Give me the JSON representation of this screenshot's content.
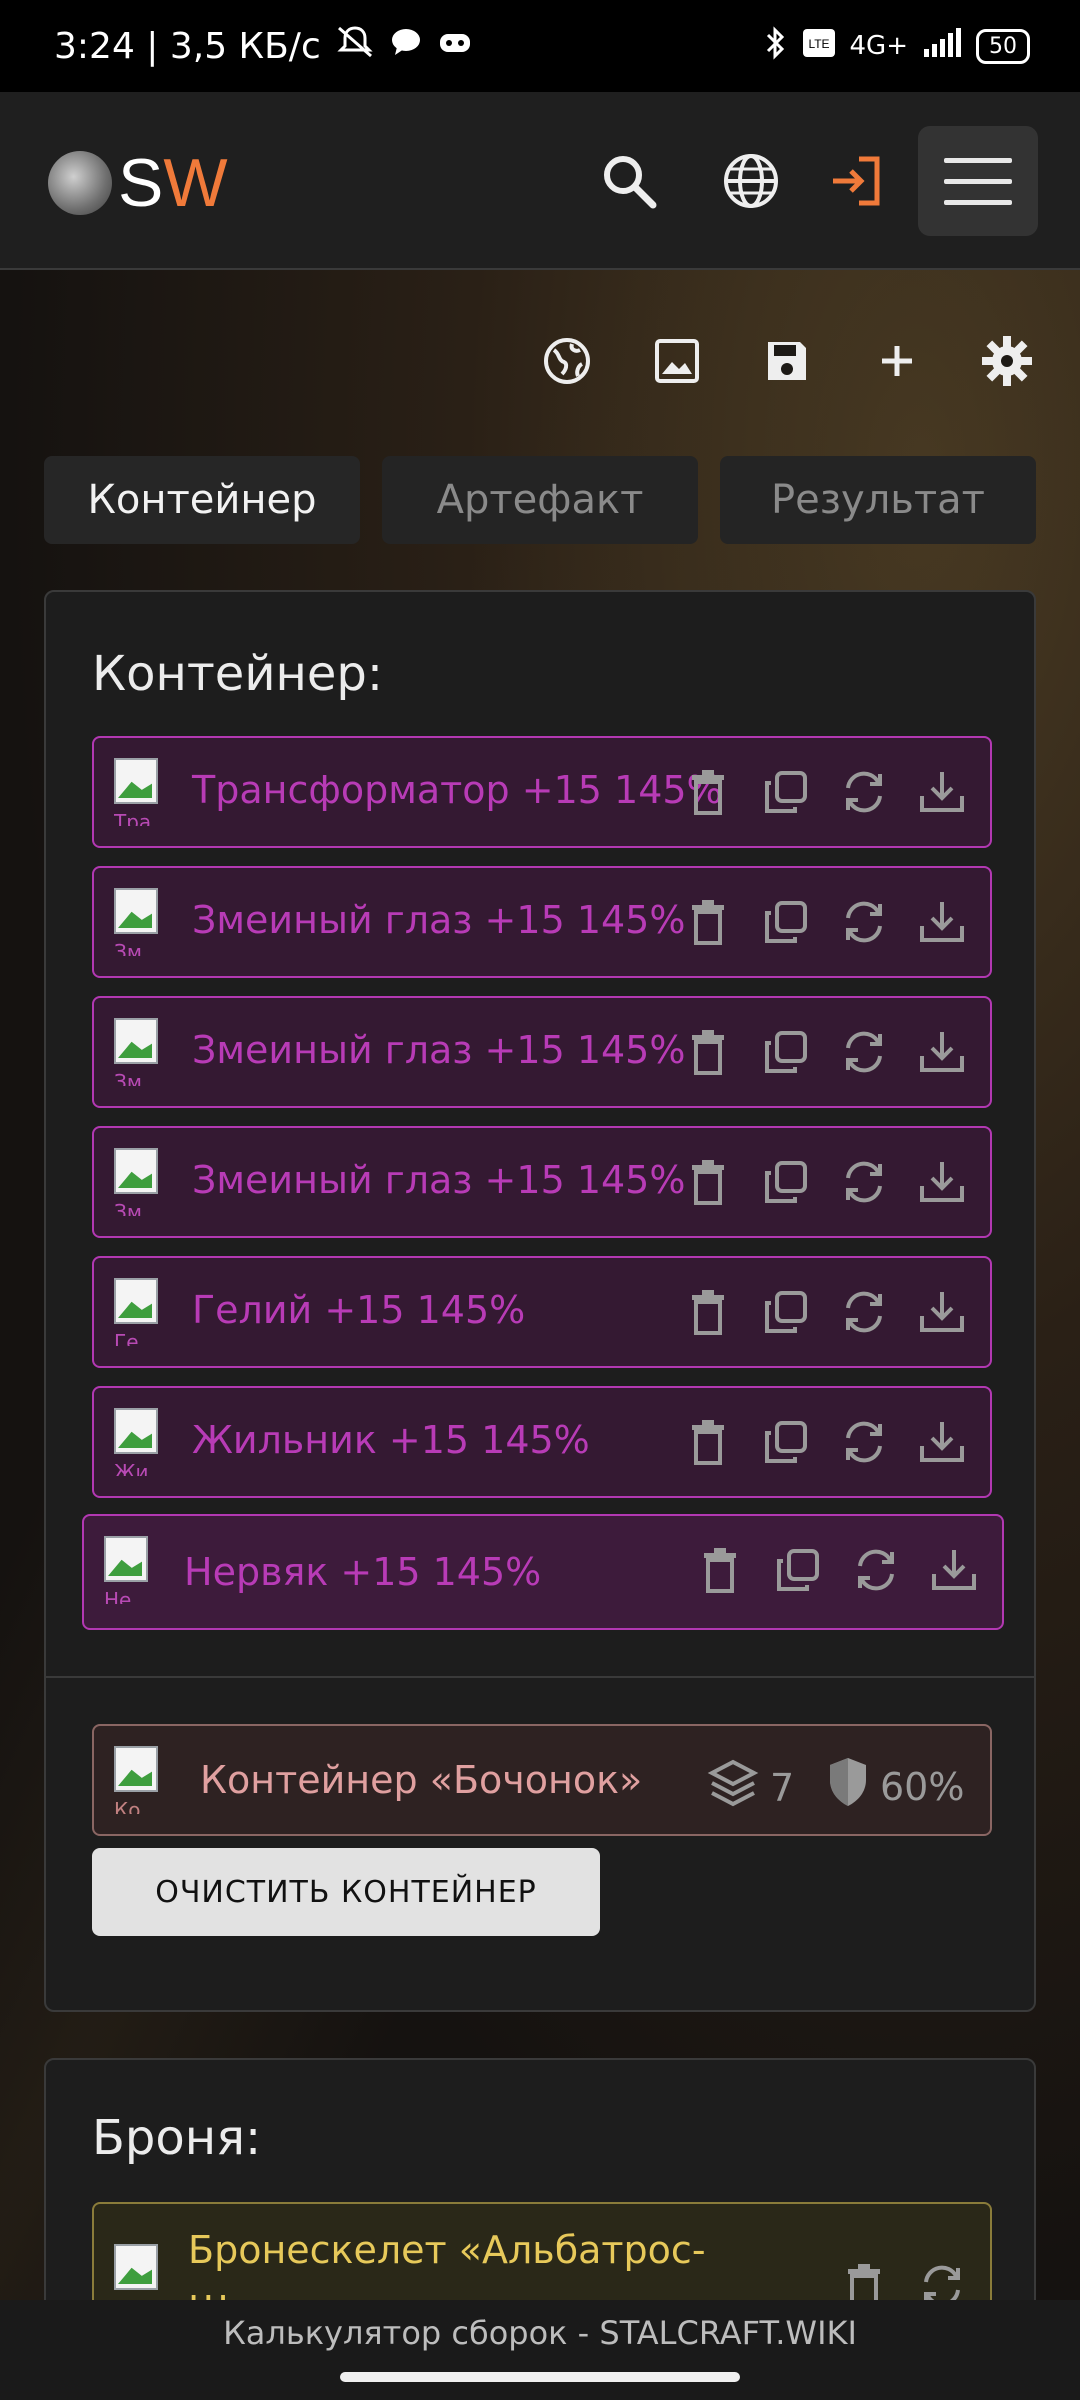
{
  "status_bar": {
    "time_speed": "3:24 | 3,5 КБ/с",
    "network": "4G+",
    "battery": "50"
  },
  "header": {
    "logo_s": "S",
    "logo_w": "W"
  },
  "toolbar": {
    "icons": [
      "globe-share-icon",
      "image-icon",
      "save-icon",
      "plus-icon",
      "gear-icon"
    ]
  },
  "tabs": [
    {
      "label": "Контейнер",
      "active": true
    },
    {
      "label": "Артефакт",
      "active": false
    },
    {
      "label": "Результат",
      "active": false
    }
  ],
  "container_panel": {
    "title": "Контейнер:",
    "artifacts": [
      {
        "name": "Трансформатор +15 145%",
        "alt_stub": "Тра"
      },
      {
        "name": "Змеиный глаз +15 145%",
        "alt_stub": "Зм"
      },
      {
        "name": "Змеиный глаз +15 145%",
        "alt_stub": "Зм"
      },
      {
        "name": "Змеиный глаз +15 145%",
        "alt_stub": "Зм"
      },
      {
        "name": "Гелий +15 145%",
        "alt_stub": "Ге"
      },
      {
        "name": "Жильник +15 145%",
        "alt_stub": "Жи"
      },
      {
        "name": "Нервяк +15 145%",
        "alt_stub": "Не"
      }
    ],
    "container": {
      "name": "Контейнер «Бочонок»",
      "slots": "7",
      "protection": "60%",
      "alt_stub": "Ко"
    },
    "clear_button": "ОЧИСТИТЬ КОНТЕЙНЕР"
  },
  "armor_panel": {
    "title": "Броня:",
    "armor": {
      "name": "Бронескелет «Альбатрос-",
      "line2": "Ш"
    }
  },
  "footer": {
    "title": "Калькулятор сборок - STALCRAFT.WIKI"
  },
  "colors": {
    "artifact_border": "#b238b2",
    "artifact_text": "#b83bb6",
    "logo_accent": "#f07a3a",
    "armor_text": "#e7c95a"
  }
}
